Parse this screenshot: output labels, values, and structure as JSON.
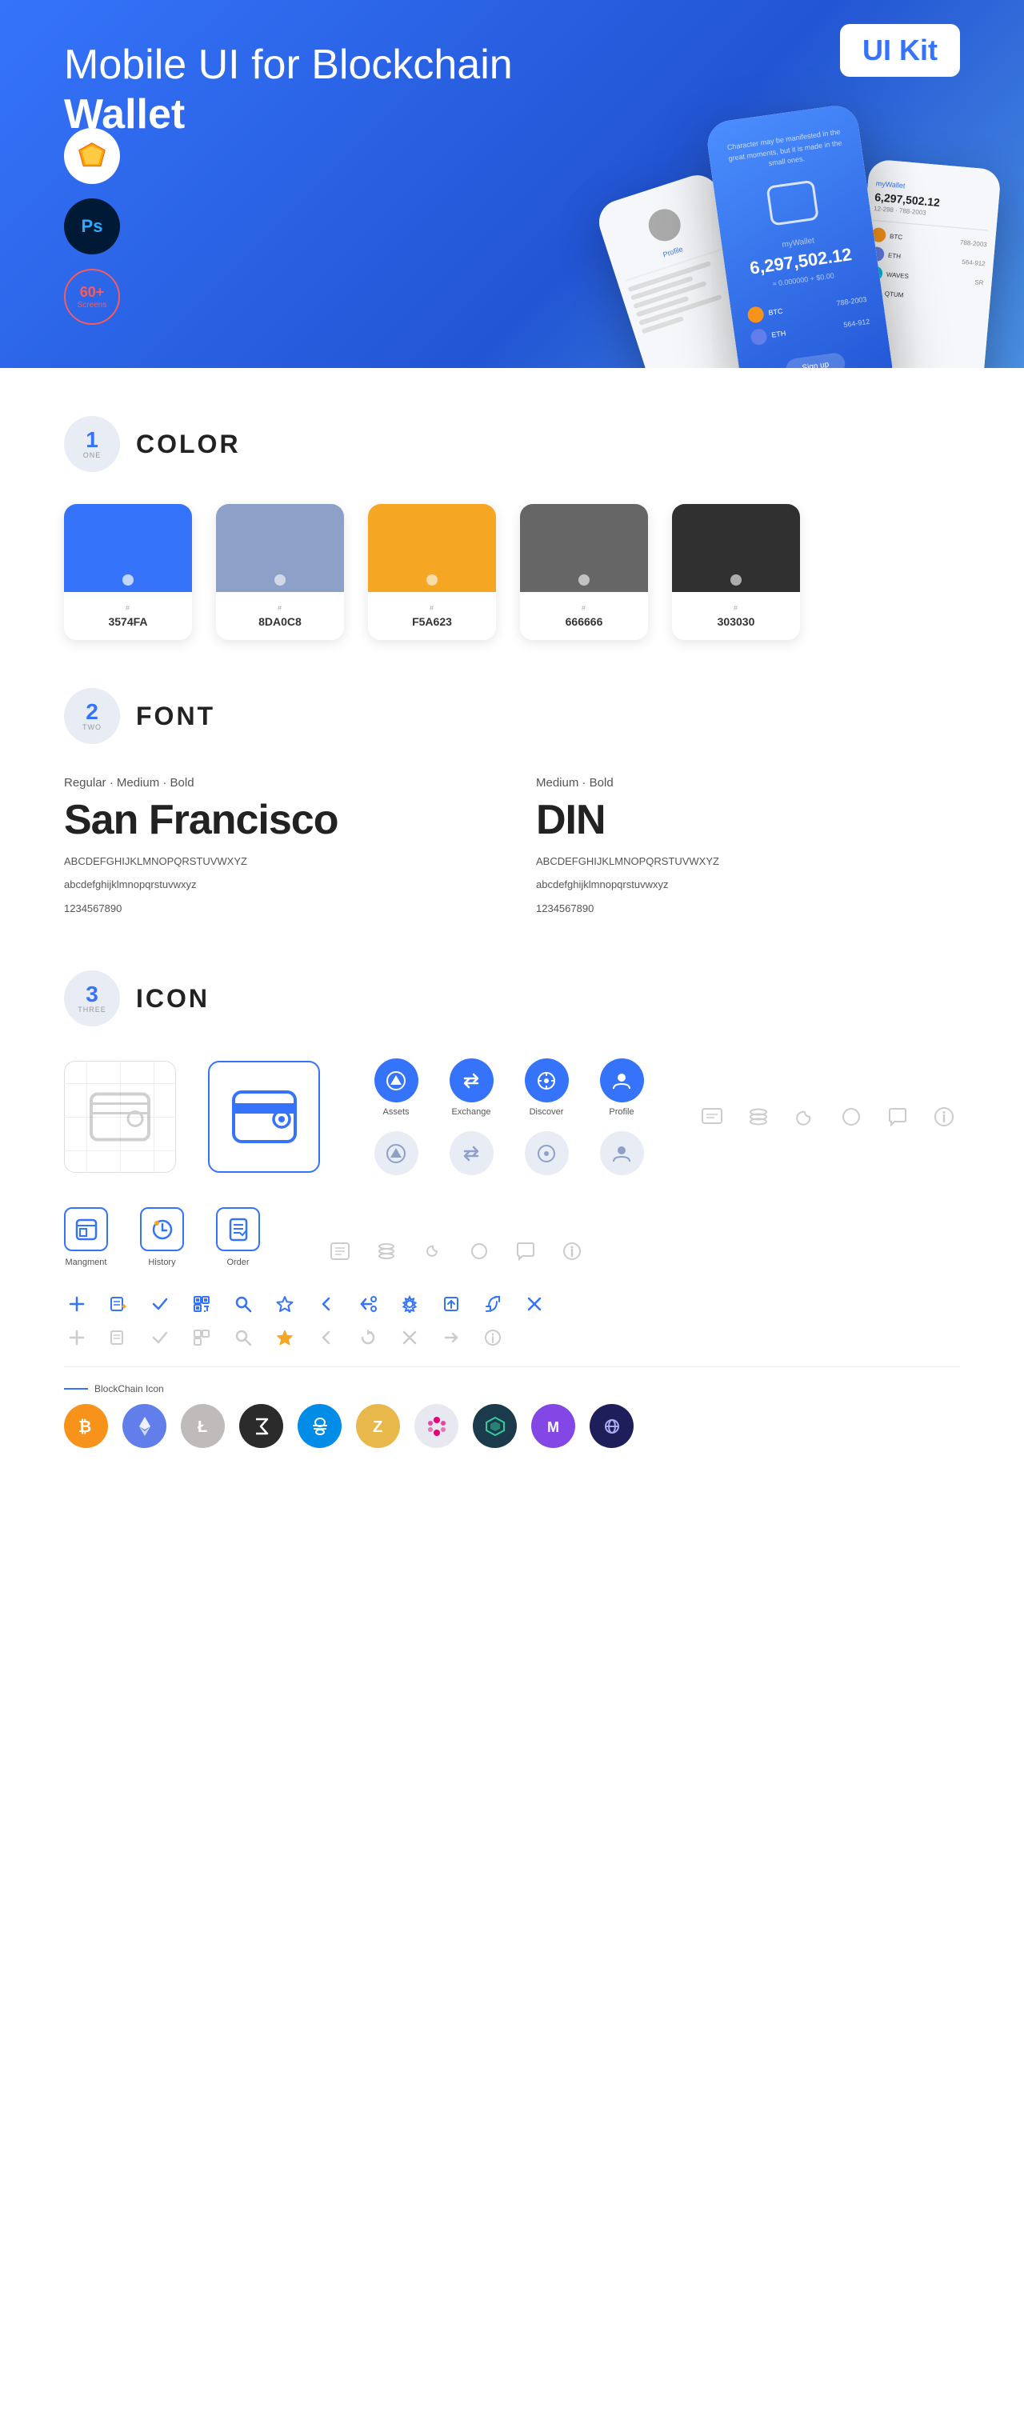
{
  "hero": {
    "title_regular": "Mobile UI for Blockchain ",
    "title_bold": "Wallet",
    "badge": "UI Kit",
    "badge_sketch": "Sketch",
    "badge_ps": "Ps",
    "badge_screens_line1": "60+",
    "badge_screens_line2": "Screens"
  },
  "sections": {
    "color": {
      "number": "1",
      "word": "ONE",
      "title": "COLOR",
      "swatches": [
        {
          "hex": "#3574FA",
          "label": "#",
          "code": "3574FA"
        },
        {
          "hex": "#8DA0C8",
          "label": "#",
          "code": "8DA0C8"
        },
        {
          "hex": "#F5A623",
          "label": "#",
          "code": "F5A623"
        },
        {
          "hex": "#666666",
          "label": "#",
          "code": "666666"
        },
        {
          "hex": "#303030",
          "label": "#",
          "code": "303030"
        }
      ]
    },
    "font": {
      "number": "2",
      "word": "TWO",
      "title": "FONT",
      "font1": {
        "weights": "Regular · Medium · Bold",
        "name": "San Francisco",
        "uppercase": "ABCDEFGHIJKLMNOPQRSTUVWXYZ",
        "lowercase": "abcdefghijklmnopqrstuvwxyz",
        "numbers": "1234567890"
      },
      "font2": {
        "weights": "Medium · Bold",
        "name": "DIN",
        "uppercase": "ABCDEFGHIJKLMNOPQRSTUVWXYZ",
        "lowercase": "abcdefghijklmnopqrstuvwxyz",
        "numbers": "1234567890"
      }
    },
    "icon": {
      "number": "3",
      "word": "THREE",
      "title": "ICON",
      "nav_icons": [
        {
          "label": "Mangment"
        },
        {
          "label": "History"
        },
        {
          "label": "Order"
        }
      ],
      "circle_icons": [
        {
          "label": "Assets"
        },
        {
          "label": "Exchange"
        },
        {
          "label": "Discover"
        },
        {
          "label": "Profile"
        }
      ],
      "blockchain_label": "BlockChain Icon",
      "crypto": [
        {
          "name": "Bitcoin",
          "color": "#F7931A",
          "symbol": "₿"
        },
        {
          "name": "Ethereum",
          "color": "#627EEA",
          "symbol": "Ξ"
        },
        {
          "name": "Litecoin",
          "color": "#BFBBBB",
          "symbol": "Ł"
        },
        {
          "name": "Zcash",
          "color": "#2B2B2B",
          "symbol": "Z"
        },
        {
          "name": "Dash",
          "color": "#008CE7",
          "symbol": "D"
        },
        {
          "name": "Zcash2",
          "color": "#E8B84B",
          "symbol": "Z"
        },
        {
          "name": "Polkadot",
          "color": "#E6007A",
          "symbol": "◉"
        },
        {
          "name": "Kyber",
          "color": "#31CB9E",
          "symbol": "K"
        },
        {
          "name": "Matic",
          "color": "#8247E5",
          "symbol": "M"
        },
        {
          "name": "Balancer",
          "color": "#1E1E5B",
          "symbol": "B"
        }
      ]
    }
  }
}
